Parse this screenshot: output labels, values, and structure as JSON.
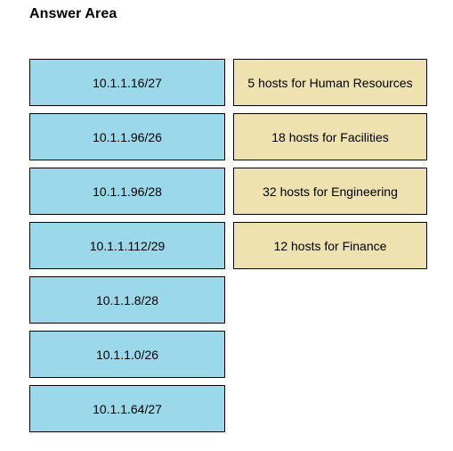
{
  "page": {
    "title": "Answer Area",
    "background_color": "#ffffff"
  },
  "colors": {
    "subnet_tile_fill": "#9BD9EA",
    "requirement_tile_fill": "#EEE2B0",
    "tile_border": "#000000",
    "text": "#000000"
  },
  "options_column": {
    "name": "subnet-options",
    "tiles": [
      {
        "label": "10.1.1.16/27"
      },
      {
        "label": "10.1.1.96/26"
      },
      {
        "label": "10.1.1.96/28"
      },
      {
        "label": "10.1.1.112/29"
      },
      {
        "label": "10.1.1.8/28"
      },
      {
        "label": "10.1.1.0/26"
      },
      {
        "label": "10.1.1.64/27"
      }
    ]
  },
  "targets_column": {
    "name": "host-requirements",
    "tiles": [
      {
        "label": "5 hosts for Human Resources"
      },
      {
        "label": "18 hosts for Facilities"
      },
      {
        "label": "32 hosts for Engineering"
      },
      {
        "label": "12 hosts for Finance"
      }
    ]
  }
}
